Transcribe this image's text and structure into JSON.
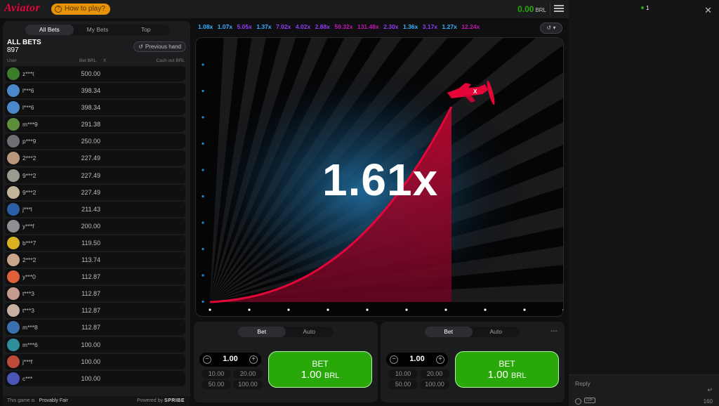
{
  "header": {
    "logo": "Aviator",
    "how_to_play": "How to play?",
    "balance": "0.00",
    "currency": "BRL"
  },
  "bets": {
    "tabs": [
      "All Bets",
      "My Bets",
      "Top"
    ],
    "title": "ALL BETS",
    "count": "897",
    "previous_hand": "Previous hand",
    "columns": {
      "user": "User",
      "bet": "Bet BRL",
      "x": "X",
      "cashout": "Cash out BRL"
    },
    "rows": [
      {
        "user": "z***t",
        "bet": "500.00",
        "color": "#3b7d2b"
      },
      {
        "user": "l***6",
        "bet": "398.34",
        "color": "#4a88c9"
      },
      {
        "user": "l***6",
        "bet": "398.34",
        "color": "#4a88c9"
      },
      {
        "user": "m***9",
        "bet": "291.38",
        "color": "#5f8e3a"
      },
      {
        "user": "p***9",
        "bet": "250.00",
        "color": "#6f6f73"
      },
      {
        "user": "2***2",
        "bet": "227.49",
        "color": "#b8987c"
      },
      {
        "user": "9***2",
        "bet": "227.49",
        "color": "#9a9a8f"
      },
      {
        "user": "9***2",
        "bet": "227.49",
        "color": "#c2b59a"
      },
      {
        "user": "j***l",
        "bet": "211.43",
        "color": "#2d5fa8"
      },
      {
        "user": "y***f",
        "bet": "200.00",
        "color": "#8d8f94"
      },
      {
        "user": "b***7",
        "bet": "119.50",
        "color": "#d9b21f"
      },
      {
        "user": "2***2",
        "bet": "113.74",
        "color": "#c9a58c"
      },
      {
        "user": "y***0",
        "bet": "112.87",
        "color": "#e0603c"
      },
      {
        "user": "t***3",
        "bet": "112.87",
        "color": "#c49b8e"
      },
      {
        "user": "t***3",
        "bet": "112.87",
        "color": "#c8b0a2"
      },
      {
        "user": "m***8",
        "bet": "112.87",
        "color": "#3a6fb0"
      },
      {
        "user": "m***6",
        "bet": "100.00",
        "color": "#2f8f9c"
      },
      {
        "user": "j***f",
        "bet": "100.00",
        "color": "#c04a3a"
      },
      {
        "user": "c***",
        "bet": "100.00",
        "color": "#4a55b8"
      }
    ],
    "footer_game": "This game is",
    "footer_pf": "Provably Fair",
    "footer_powered": "Powered by",
    "footer_brand": "SPRIBE"
  },
  "history": [
    {
      "v": "1.08x",
      "c": "#34b4ff"
    },
    {
      "v": "1.07x",
      "c": "#34b4ff"
    },
    {
      "v": "5.05x",
      "c": "#913ef8"
    },
    {
      "v": "1.37x",
      "c": "#34b4ff"
    },
    {
      "v": "7.02x",
      "c": "#913ef8"
    },
    {
      "v": "4.02x",
      "c": "#913ef8"
    },
    {
      "v": "2.88x",
      "c": "#913ef8"
    },
    {
      "v": "59.32x",
      "c": "#c017b4"
    },
    {
      "v": "131.48x",
      "c": "#c017b4"
    },
    {
      "v": "2.30x",
      "c": "#913ef8"
    },
    {
      "v": "1.36x",
      "c": "#34b4ff"
    },
    {
      "v": "3.17x",
      "c": "#913ef8"
    },
    {
      "v": "1.27x",
      "c": "#34b4ff"
    },
    {
      "v": "12.24x",
      "c": "#c017b4"
    }
  ],
  "game": {
    "multiplier": "1.61x",
    "accent": "#e50539"
  },
  "bet_panels": [
    {
      "tabs": [
        "Bet",
        "Auto"
      ],
      "stake": "1.00",
      "quick": [
        "10.00",
        "20.00",
        "50.00",
        "100.00"
      ],
      "button_label": "BET",
      "button_amount": "1.00",
      "button_currency": "BRL"
    },
    {
      "tabs": [
        "Bet",
        "Auto"
      ],
      "stake": "1.00",
      "quick": [
        "10.00",
        "20.00",
        "50.00",
        "100.00"
      ],
      "button_label": "BET",
      "button_amount": "1.00",
      "button_currency": "BRL",
      "more": "---"
    }
  ],
  "chat": {
    "online": "1",
    "placeholder": "Reply",
    "gif": "GIF",
    "char_count": "160"
  }
}
